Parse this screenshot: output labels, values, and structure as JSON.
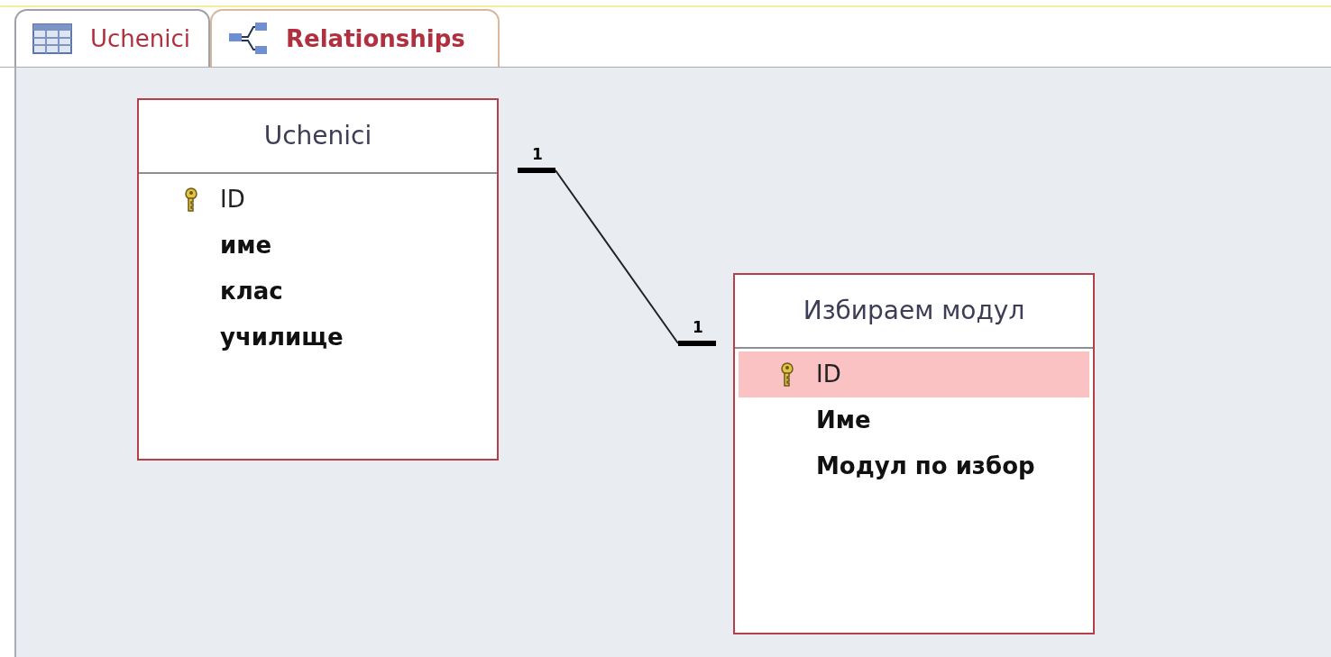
{
  "tabs": [
    {
      "label": "Uchenici",
      "kind": "table",
      "selected": false
    },
    {
      "label": "Relationships",
      "kind": "relationships",
      "selected": true
    }
  ],
  "tables": [
    {
      "title": "Uchenici",
      "fields": [
        {
          "name": "ID",
          "primary_key": true,
          "selected": false
        },
        {
          "name": "име",
          "primary_key": false,
          "selected": false
        },
        {
          "name": "клас",
          "primary_key": false,
          "selected": false
        },
        {
          "name": "училище",
          "primary_key": false,
          "selected": false
        }
      ]
    },
    {
      "title": "Избираем модул",
      "fields": [
        {
          "name": "ID",
          "primary_key": true,
          "selected": true
        },
        {
          "name": "Име",
          "primary_key": false,
          "selected": false
        },
        {
          "name": "Модул по избор",
          "primary_key": false,
          "selected": false
        }
      ]
    }
  ],
  "relationships": [
    {
      "from_label": "1",
      "to_label": "1"
    }
  ]
}
